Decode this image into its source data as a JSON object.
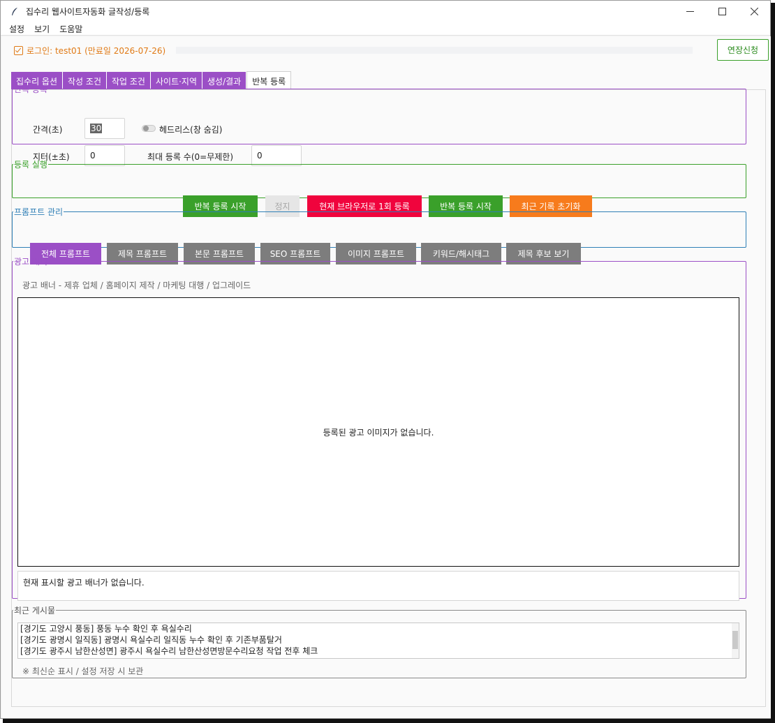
{
  "window": {
    "title": "집수리 웹사이트자동화 글작성/등록"
  },
  "menu": [
    "설정",
    "보기",
    "도움말"
  ],
  "login": {
    "text": "로그인: test01 (만료일 2026-07-26)",
    "extend_label": "연장신청",
    "progress_fraction": 0.0
  },
  "tabs": [
    "집수리 옵션",
    "작성 조건",
    "작업 조건",
    "사이트·지역",
    "생성/결과",
    "반복 등록"
  ],
  "active_tab": "반복 등록",
  "repeat": {
    "legend": "반복 등록",
    "interval_label": "간격(초)",
    "interval_value": "30",
    "headless_label": "헤드리스(창 숨김)",
    "headless_on": false,
    "jitter_label": "지터(±초)",
    "jitter_value": "0",
    "max_label": "최대 등록 수(0=무제한)",
    "max_value": "0"
  },
  "run": {
    "legend": "등록 실행",
    "start1": "반복 등록 시작",
    "stop": "정지",
    "once": "현재 브라우저로 1회 등록",
    "start2": "반복 등록 시작",
    "reset": "최근 기록 초기화"
  },
  "prompt": {
    "legend": "프롬프트 관리",
    "buttons": [
      "전체 프롬프트",
      "제목 프롬프트",
      "본문 프롬프트",
      "SEO 프롬프트",
      "이미지 프롬프트",
      "키워드/해시태그",
      "제목 후보 보기"
    ]
  },
  "ad": {
    "legend": "광고 배너",
    "subtitle": "광고 배너 - 제휴 업체 / 홈페이지 제작 / 마케팅 대행 / 업그레이드",
    "empty_image": "등록된 광고 이미지가 없습니다.",
    "status": "현재 표시할 광고 배너가 없습니다."
  },
  "recent": {
    "legend": "최근 게시물",
    "items": [
      "[경기도 고양시 풍동] 풍동 누수 확인 후 욕실수리",
      "[경기도 광명시 일직동] 광명시 욕실수리 일직동 누수 확인 후 기존부품탈거",
      "[경기도 광주시 남한산성면] 광주시 욕실수리 남한산성면방문수리요청 작업 전후 체크"
    ],
    "note": "※ 최신순 표시 / 설정 저장 시 보관"
  },
  "colors": {
    "purple": "#9b4fc6",
    "green": "#3aa02a",
    "red": "#f0043d",
    "orange": "#f77b1c",
    "gray": "#7d7d7d",
    "disabled": "#e6e6e6",
    "blue": "#2f7fb6",
    "login_orange": "#e07a16"
  }
}
